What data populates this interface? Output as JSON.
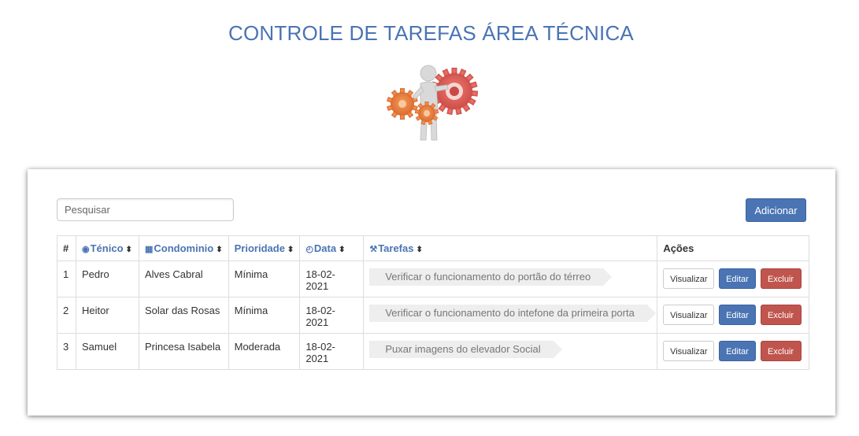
{
  "page": {
    "title": "CONTROLE DE TAREFAS ÁREA TÉCNICA",
    "logo_icon": "person-with-gears-icon"
  },
  "search": {
    "placeholder": "Pesquisar"
  },
  "toolbar": {
    "add_label": "Adicionar"
  },
  "table": {
    "headers": {
      "index": "#",
      "tecnico": "Ténico",
      "condominio": "Condominio",
      "prioridade": "Prioridade",
      "data": "Data",
      "tarefas": "Tarefas",
      "acoes": "Ações"
    },
    "rows": [
      {
        "num": "1",
        "tecnico": "Pedro",
        "condominio": "Alves Cabral",
        "prioridade": "Mínima",
        "data": "18-02-2021",
        "tarefa": "Verificar o funcionamento do portão do térreo"
      },
      {
        "num": "2",
        "tecnico": "Heitor",
        "condominio": "Solar das Rosas",
        "prioridade": "Mínima",
        "data": "18-02-2021",
        "tarefa": "Verificar o funcionamento do intefone da primeira porta"
      },
      {
        "num": "3",
        "tecnico": "Samuel",
        "condominio": "Princesa Isabela",
        "prioridade": "Moderada",
        "data": "18-02-2021",
        "tarefa": "Puxar imagens do elevador Social"
      }
    ],
    "actions": {
      "view": "Visualizar",
      "edit": "Editar",
      "delete": "Excluir"
    }
  },
  "colors": {
    "primary": "#4a74b3",
    "danger": "#c0554d",
    "tag_bg": "#eeeeee"
  }
}
